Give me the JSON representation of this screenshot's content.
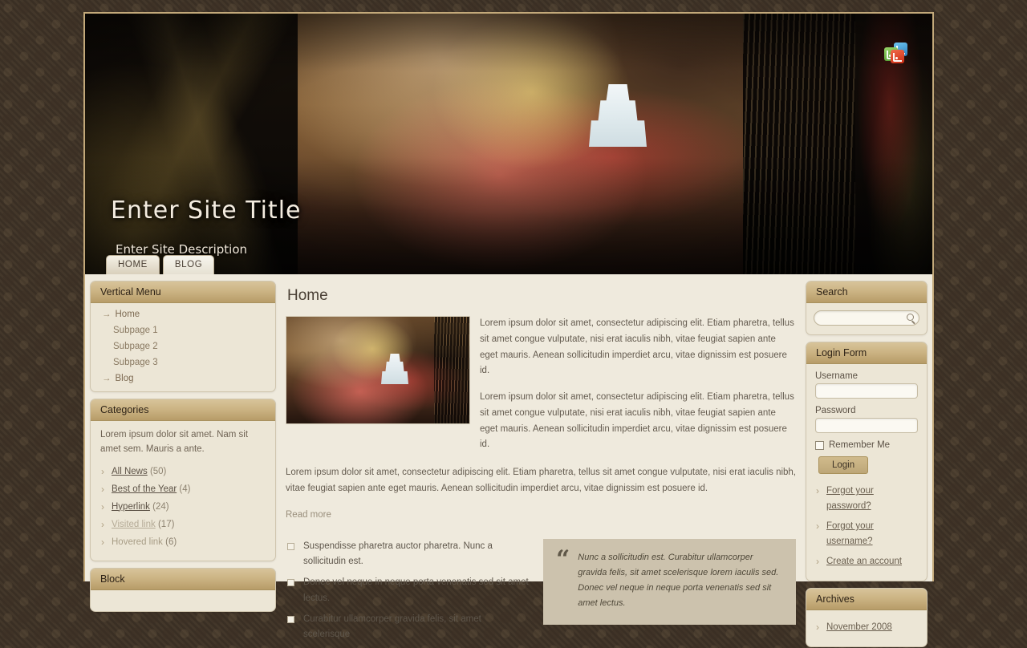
{
  "site": {
    "title": "Enter Site Title",
    "description": "Enter Site Description"
  },
  "social": {
    "rss_icon": "rss-icon",
    "share_icon": "share-icon",
    "feed_icon": "feed-icon"
  },
  "tabs": [
    {
      "label": "HOME"
    },
    {
      "label": "BLOG"
    }
  ],
  "sidebar_left": {
    "vertical_menu": {
      "title": "Vertical Menu",
      "items": [
        {
          "label": "Home",
          "level": 0,
          "arrow": "→"
        },
        {
          "label": "Subpage 1",
          "level": 1
        },
        {
          "label": "Subpage 2",
          "level": 1
        },
        {
          "label": "Subpage 3",
          "level": 1
        },
        {
          "label": "Blog",
          "level": 0,
          "arrow": "→"
        }
      ]
    },
    "categories": {
      "title": "Categories",
      "intro": "Lorem ipsum dolor sit amet. Nam sit amet sem. Mauris a ante.",
      "items": [
        {
          "label": "All News",
          "count": "(50)",
          "state": "link"
        },
        {
          "label": "Best of the Year",
          "count": "(4)",
          "state": "link"
        },
        {
          "label": "Hyperlink",
          "count": "(24)",
          "state": "link"
        },
        {
          "label": "Visited link",
          "count": "(17)",
          "state": "visited"
        },
        {
          "label": "Hovered link",
          "count": "(6)",
          "state": "hovered"
        }
      ]
    },
    "block": {
      "title": "Block"
    }
  },
  "main": {
    "page_title": "Home",
    "thumbnail_alt": "article-thumbnail",
    "paragraph_1": "Lorem ipsum dolor sit amet, consectetur adipiscing elit. Etiam pharetra, tellus sit amet congue vulputate, nisi erat iaculis nibh, vitae feugiat sapien ante eget mauris. Aenean sollicitudin imperdiet arcu, vitae dignissim est posuere id.",
    "paragraph_2": "Lorem ipsum dolor sit amet, consectetur adipiscing elit. Etiam pharetra, tellus sit amet congue vulputate, nisi erat iaculis nibh, vitae feugiat sapien ante eget mauris. Aenean sollicitudin imperdiet arcu, vitae dignissim est posuere id.",
    "paragraph_3": "Lorem ipsum dolor sit amet, consectetur adipiscing elit. Etiam pharetra, tellus sit amet congue vulputate, nisi erat iaculis nibh, vitae feugiat sapien ante eget mauris. Aenean sollicitudin imperdiet arcu, vitae dignissim est posuere id.",
    "read_more": "Read more",
    "bullets": [
      "Suspendisse pharetra auctor pharetra. Nunc a sollicitudin est.",
      "Donec vel neque in neque porta venenatis sed sit amet lectus.",
      "Curabitur ullamcorper gravida felis, sit amet scelerisque"
    ],
    "quote": {
      "mark": "“",
      "text": "Nunc a sollicitudin est. Curabitur ullamcorper gravida felis, sit amet scelerisque lorem iaculis sed. Donec vel neque in neque porta venenatis sed sit amet lectus."
    }
  },
  "sidebar_right": {
    "search": {
      "title": "Search",
      "value": "",
      "placeholder": "",
      "icon": "magnifier-icon"
    },
    "login": {
      "title": "Login Form",
      "username_label": "Username",
      "username_value": "",
      "password_label": "Password",
      "password_value": "",
      "remember_label": "Remember Me",
      "login_button": "Login",
      "links": [
        "Forgot your password?",
        "Forgot your username?",
        "Create an account"
      ]
    },
    "archives": {
      "title": "Archives",
      "items": [
        "November 2008"
      ]
    }
  },
  "colors": {
    "accent": "#b79c68",
    "panel": "#ece6d6",
    "page_bg": "#efeadd",
    "backdrop": "#3a2f24",
    "text": "#5c5246"
  }
}
